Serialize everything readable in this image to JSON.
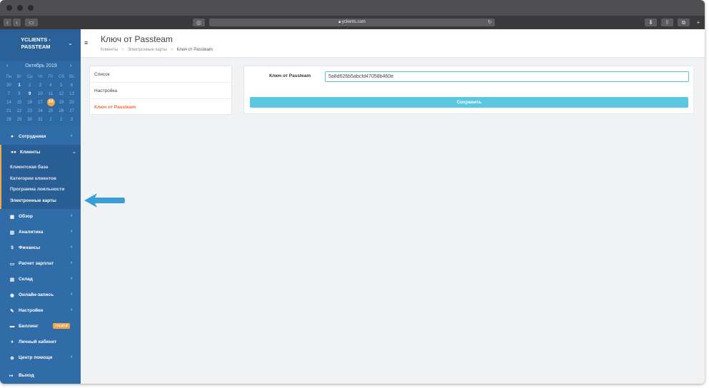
{
  "browser": {
    "url": "yclients.com"
  },
  "brand": {
    "name": "YCLIENTS - PASSTEAM"
  },
  "calendar": {
    "month": "Октябрь 2019",
    "weekdays": [
      "Пн",
      "Вт",
      "Ср",
      "Чт",
      "Пт",
      "Сб",
      "Вс"
    ],
    "weeks": [
      [
        "30",
        "1",
        "2",
        "3",
        "4",
        "5",
        "6"
      ],
      [
        "7",
        "8",
        "9",
        "10",
        "11",
        "12",
        "13"
      ],
      [
        "14",
        "15",
        "16",
        "17",
        "18",
        "19",
        "20"
      ],
      [
        "21",
        "22",
        "23",
        "24",
        "25",
        "26",
        "27"
      ],
      [
        "28",
        "29",
        "30",
        "31",
        "1",
        "2",
        "3"
      ]
    ],
    "today": "18"
  },
  "sidebar": {
    "items": [
      {
        "label": "Сотрудники",
        "icon": "user-icon"
      },
      {
        "label": "Клиенты",
        "icon": "users-icon"
      },
      {
        "label": "Обзор",
        "icon": "grid-icon"
      },
      {
        "label": "Аналитика",
        "icon": "bar-chart-icon"
      },
      {
        "label": "Финансы",
        "icon": "dollar-icon"
      },
      {
        "label": "Расчет зарплат",
        "icon": "payroll-icon"
      },
      {
        "label": "Склад",
        "icon": "box-icon"
      },
      {
        "label": "Онлайн-запись",
        "icon": "globe-icon"
      },
      {
        "label": "Настройки",
        "icon": "wrench-icon"
      },
      {
        "label": "Биллинг",
        "icon": "billing-icon"
      },
      {
        "label": "Личный кабинет",
        "icon": "person-icon"
      },
      {
        "label": "Центр помощи",
        "icon": "help-icon"
      }
    ],
    "sub_items": [
      "Клиентская база",
      "Категории клиентов",
      "Программа лояльности",
      "Электронные карты"
    ],
    "billing_badge": "774,53 ₽",
    "logout": "Выход"
  },
  "header": {
    "title": "Ключ от Passteam",
    "breadcrumbs": [
      "Клиенты",
      "Электронные карты",
      "Ключ от Passteam"
    ]
  },
  "menu": {
    "items": [
      "Список",
      "Настройка",
      "Ключ от Passteam"
    ]
  },
  "form": {
    "label": "Ключ от Passteam",
    "value": "5a8d626b5abcfd47058b460e",
    "save_label": "Сохранить"
  },
  "colors": {
    "sidebar": "#2f6ca8",
    "accent": "#f0a64b",
    "active_link": "#f26b3a",
    "save_button": "#5bc7e0",
    "arrow": "#3a9fd8"
  }
}
